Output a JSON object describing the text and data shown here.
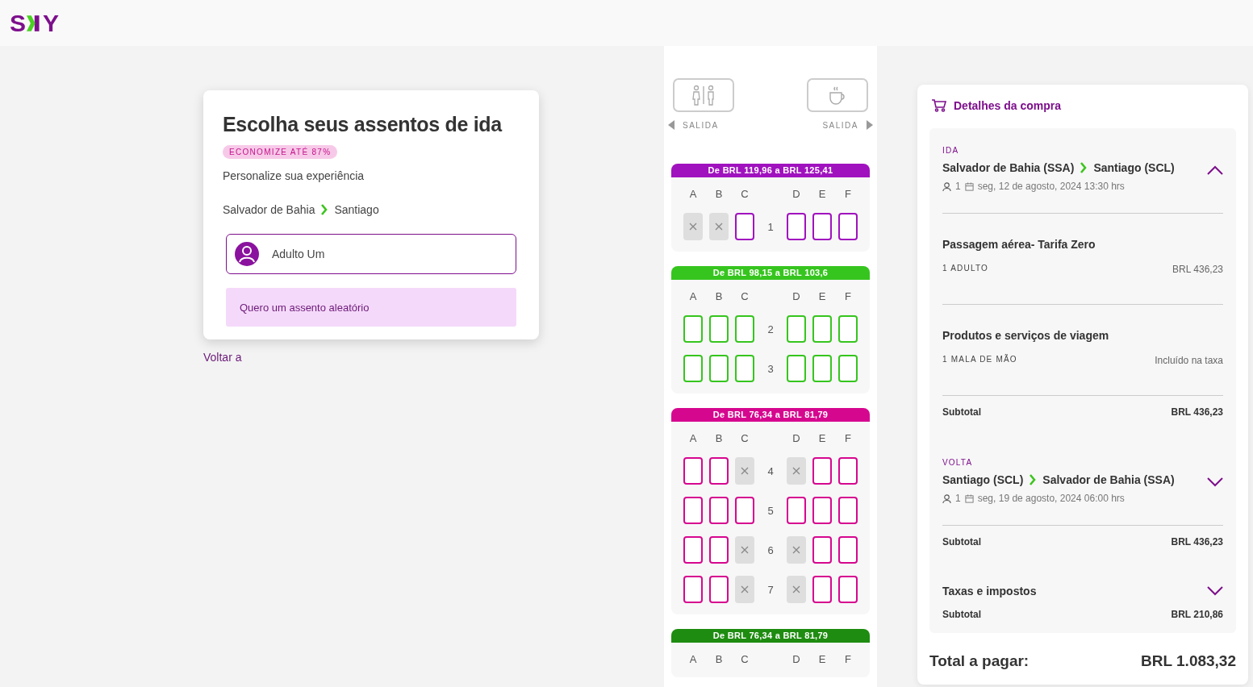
{
  "logo": {
    "left": "S",
    "right": "Y"
  },
  "selection": {
    "title": "Escolha seus assentos de ida",
    "badge": "ECONOMIZE ATÉ 87%",
    "subtitle": "Personalize sua experiência",
    "route": {
      "from": "Salvador de Bahia",
      "to": "Santiago"
    },
    "passengers": [
      {
        "name": "Adulto Um",
        "selected": true
      }
    ],
    "random_button": "Quero um assento aleatório"
  },
  "back_link": "Voltar a",
  "seat_map": {
    "facilities": [
      {
        "kind": "restroom",
        "label": "SALIDA"
      },
      {
        "kind": "galley",
        "label": "SALIDA"
      }
    ],
    "sections": [
      {
        "price": "De BRL 119,96 a BRL 125,41",
        "color": "#a012be",
        "columns": [
          "A",
          "B",
          "C",
          "D",
          "E",
          "F"
        ],
        "rows": [
          {
            "number": "1",
            "seats": [
              {
                "available": false
              },
              {
                "available": false
              },
              {
                "available": true
              },
              {
                "available": true
              },
              {
                "available": true
              },
              {
                "available": true
              }
            ]
          }
        ]
      },
      {
        "price": "De BRL 98,15 a BRL 103,6",
        "color": "#36c51e",
        "columns": [
          "A",
          "B",
          "C",
          "D",
          "E",
          "F"
        ],
        "rows": [
          {
            "number": "2",
            "seats": [
              {
                "available": true
              },
              {
                "available": true
              },
              {
                "available": true
              },
              {
                "available": true
              },
              {
                "available": true
              },
              {
                "available": true
              }
            ]
          },
          {
            "number": "3",
            "seats": [
              {
                "available": true
              },
              {
                "available": true
              },
              {
                "available": true
              },
              {
                "available": true
              },
              {
                "available": true
              },
              {
                "available": true
              }
            ]
          }
        ]
      },
      {
        "price": "De BRL 76,34 a BRL 81,79",
        "color": "#d6078f",
        "columns": [
          "A",
          "B",
          "C",
          "D",
          "E",
          "F"
        ],
        "rows": [
          {
            "number": "4",
            "seats": [
              {
                "available": true
              },
              {
                "available": true
              },
              {
                "available": false
              },
              {
                "available": false
              },
              {
                "available": true
              },
              {
                "available": true
              }
            ]
          },
          {
            "number": "5",
            "seats": [
              {
                "available": true
              },
              {
                "available": true
              },
              {
                "available": true
              },
              {
                "available": true
              },
              {
                "available": true
              },
              {
                "available": true
              }
            ]
          },
          {
            "number": "6",
            "seats": [
              {
                "available": true
              },
              {
                "available": true
              },
              {
                "available": false
              },
              {
                "available": false
              },
              {
                "available": true
              },
              {
                "available": true
              }
            ]
          },
          {
            "number": "7",
            "seats": [
              {
                "available": true
              },
              {
                "available": true
              },
              {
                "available": false
              },
              {
                "available": false
              },
              {
                "available": true
              },
              {
                "available": true
              }
            ]
          }
        ]
      },
      {
        "price": "De BRL 76,34 a BRL 81,79",
        "color": "#1e8c10",
        "columns": [
          "A",
          "B",
          "C",
          "D",
          "E",
          "F"
        ]
      }
    ]
  },
  "summary": {
    "title": "Detalhes da compra",
    "legs": [
      {
        "label": "IDA",
        "from": "Salvador de Bahia (SSA)",
        "to": "Santiago (SCL)",
        "passengers": "1",
        "date": "seg, 12 de agosto, 2024 13:30 hrs",
        "expanded": true,
        "items": [
          {
            "title": "Passagem aérea- Tarifa Zero",
            "detail": "1 ADULTO",
            "amount": "BRL 436,23"
          },
          {
            "title": "Produtos e serviços de viagem",
            "detail": "1 MALA DE MÃO",
            "amount": "Incluído na taxa"
          }
        ],
        "subtotal_label": "Subtotal",
        "subtotal": "BRL 436,23"
      },
      {
        "label": "VOLTA",
        "from": "Santiago (SCL)",
        "to": "Salvador de Bahia (SSA)",
        "passengers": "1",
        "date": "seg, 19 de agosto, 2024 06:00 hrs",
        "expanded": false,
        "subtotal_label": "Subtotal",
        "subtotal": "BRL 436,23"
      }
    ],
    "taxes": {
      "title": "Taxas e impostos",
      "expanded": false,
      "subtotal_label": "Subtotal",
      "subtotal": "BRL 210,86"
    },
    "total_label": "Total a pagar:",
    "total": "BRL 1.083,32"
  }
}
